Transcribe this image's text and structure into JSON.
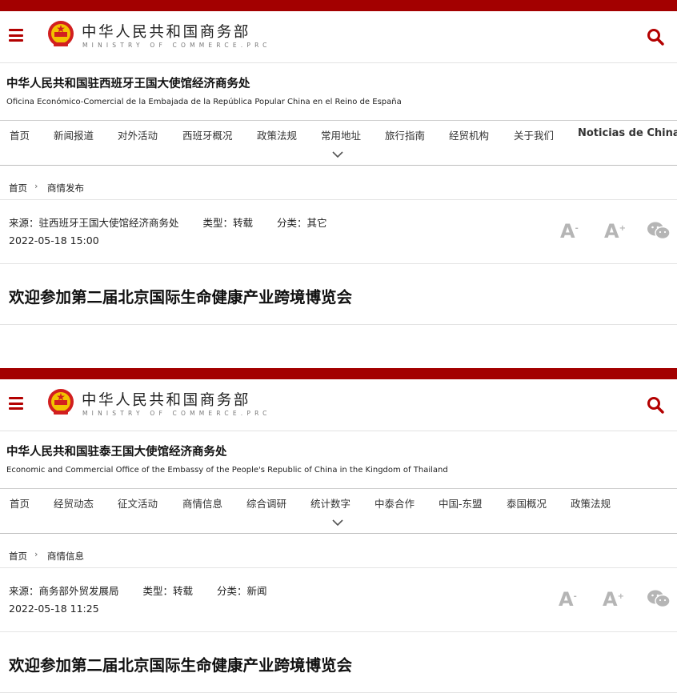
{
  "colors": {
    "brand_red": "#a30000",
    "icon_red": "#b30000",
    "muted_icon": "#b5b5b5"
  },
  "pages": [
    {
      "header": {
        "brand_cn": "中华人民共和国商务部",
        "brand_en": "MINISTRY OF COMMERCE.PRC",
        "menu_icon": "hamburger-icon",
        "search_icon": "search-icon"
      },
      "office": {
        "name_cn": "中华人民共和国驻西班牙王国大使馆经济商务处",
        "name_foreign": "Oficina Económico-Comercial de la Embajada de la República Popular China en el Reino de España"
      },
      "nav": [
        "首页",
        "新闻报道",
        "对外活动",
        "西班牙概况",
        "政策法规",
        "常用地址",
        "旅行指南",
        "经贸机构",
        "关于我们",
        "Noticias de China"
      ],
      "breadcrumb": {
        "home": "首页",
        "separator": "›",
        "current": "商情发布"
      },
      "meta": {
        "source": "来源：驻西班牙王国大使馆经济商务处",
        "type": "类型：转载",
        "category": "分类：其它",
        "date": "2022-05-18 15:00"
      },
      "font_buttons": {
        "smaller": "A",
        "smaller_mark": "-",
        "larger": "A",
        "larger_mark": "+"
      },
      "title": "欢迎参加第二届北京国际生命健康产业跨境博览会"
    },
    {
      "header": {
        "brand_cn": "中华人民共和国商务部",
        "brand_en": "MINISTRY OF COMMERCE.PRC",
        "menu_icon": "hamburger-icon",
        "search_icon": "search-icon"
      },
      "office": {
        "name_cn": "中华人民共和国驻泰王国大使馆经济商务处",
        "name_foreign": "Economic and Commercial Office of the Embassy of the People's Republic of China in the Kingdom of Thailand"
      },
      "nav": [
        "首页",
        "经贸动态",
        "征文活动",
        "商情信息",
        "综合调研",
        "统计数字",
        "中泰合作",
        "中国-东盟",
        "泰国概况",
        "政策法规"
      ],
      "breadcrumb": {
        "home": "首页",
        "separator": "›",
        "current": "商情信息"
      },
      "meta": {
        "source": "来源：商务部外贸发展局",
        "type": "类型：转载",
        "category": "分类：新闻",
        "date": "2022-05-18 11:25"
      },
      "font_buttons": {
        "smaller": "A",
        "smaller_mark": "-",
        "larger": "A",
        "larger_mark": "+"
      },
      "title": "欢迎参加第二届北京国际生命健康产业跨境博览会"
    }
  ]
}
